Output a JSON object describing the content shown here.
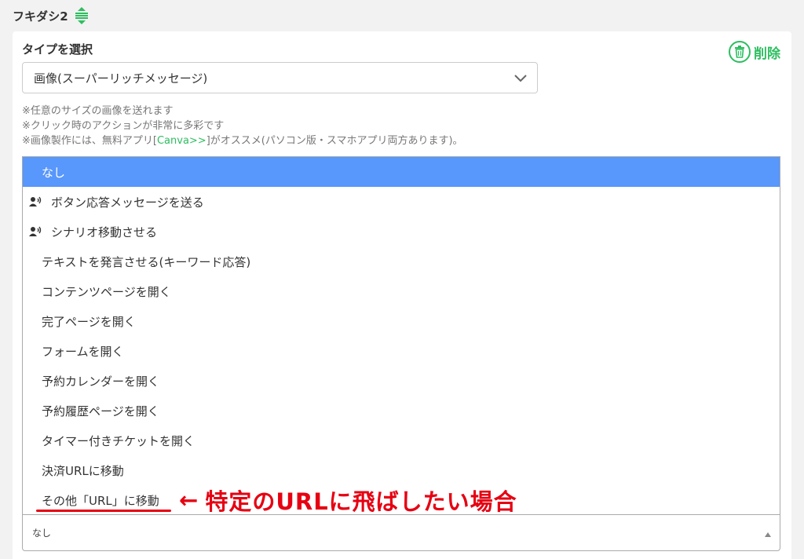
{
  "section": {
    "title": "フキダシ2",
    "drag_icon": "drag-handle-icon"
  },
  "panel": {
    "type_label": "タイプを選択",
    "delete_label": "削除",
    "type_value": "画像(スーパーリッチメッセージ)",
    "notes": {
      "line1": "※任意のサイズの画像を送れます",
      "line2": "※クリック時のアクションが非常に多彩です",
      "line3_prefix": "※画像製作には、無料アプリ[",
      "line3_link": "Canva>>",
      "line3_suffix": "]がオススメ(パソコン版・スマホアプリ両方あります)。"
    }
  },
  "dropdown": {
    "options": [
      {
        "label": "なし"
      },
      {
        "label": "ボタン応答メッセージを送る"
      },
      {
        "label": "シナリオ移動させる"
      },
      {
        "label": "テキストを発言させる(キーワード応答)"
      },
      {
        "label": "コンテンツページを開く"
      },
      {
        "label": "完了ページを開く"
      },
      {
        "label": "フォームを開く"
      },
      {
        "label": "予約カレンダーを開く"
      },
      {
        "label": "予約履歴ページを開く"
      },
      {
        "label": "タイマー付きチケットを開く"
      },
      {
        "label": "決済URLに移動"
      },
      {
        "label": "その他「URL」に移動"
      }
    ],
    "selected_value": "なし"
  },
  "annotation": {
    "arrow": "←",
    "text": "特定のURLに飛ばしたい場合"
  },
  "colors": {
    "accent_green": "#2dbe60",
    "highlight_blue": "#5897fb",
    "annotation_red": "#e60012"
  }
}
